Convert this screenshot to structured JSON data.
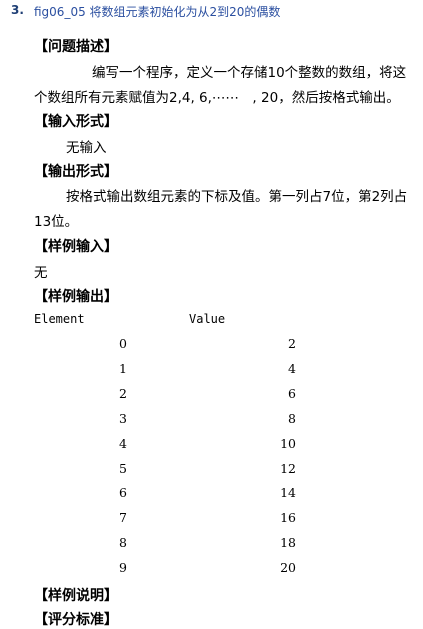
{
  "question": {
    "number": "3.",
    "title": "fig06_05 将数组元素初始化为从2到20的偶数"
  },
  "sections": {
    "problem": "【问题描述】",
    "problem_line1": "编写一个程序，定义一个存储10个整数的数组，将这",
    "problem_line2": "个数组所有元素赋值为2,4, 6,⋯⋯　, 20，然后按格式输出。",
    "input": "【输入形式】",
    "input_text": "无输入",
    "output": "【输出形式】",
    "output_line1": "按格式输出数组元素的下标及值。第一列占7位，第2列占",
    "output_line2": "13位。",
    "sample_input": "【样例输入】",
    "sample_input_text": "无",
    "sample_output": "【样例输出】",
    "sample_explain": "【样例说明】",
    "grading": "【评分标准】"
  },
  "table": {
    "header_left": "Element",
    "header_right": "Value",
    "rows": [
      {
        "index": "0",
        "value": "2"
      },
      {
        "index": "1",
        "value": "4"
      },
      {
        "index": "2",
        "value": "6"
      },
      {
        "index": "3",
        "value": "8"
      },
      {
        "index": "4",
        "value": "10"
      },
      {
        "index": "5",
        "value": "12"
      },
      {
        "index": "6",
        "value": "14"
      },
      {
        "index": "7",
        "value": "16"
      },
      {
        "index": "8",
        "value": "18"
      },
      {
        "index": "9",
        "value": "20"
      }
    ]
  }
}
